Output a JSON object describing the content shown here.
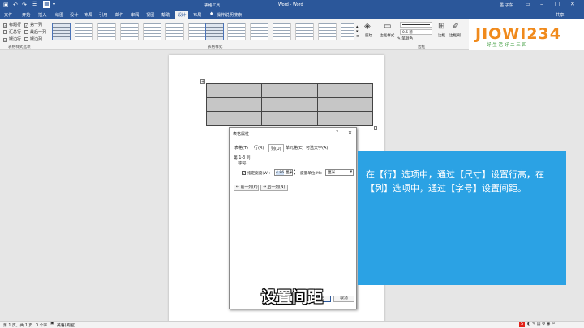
{
  "titlebar": {
    "context_tab": "表格工具",
    "doc_title": "Word - Word",
    "user": "墨 子东"
  },
  "menu": [
    "文件",
    "开始",
    "插入",
    "绘图",
    "设计",
    "布局",
    "引用",
    "邮件",
    "审阅",
    "视图",
    "帮助",
    "设计",
    "布局",
    "操作说明搜索",
    "共享"
  ],
  "ribbon": {
    "options": [
      "标题行",
      "第一列",
      "汇总行",
      "最后一列",
      "镶边行",
      "镶边列"
    ],
    "options_checked": [
      true,
      true,
      false,
      false,
      true,
      false
    ],
    "group_style_options": "表格样式选项",
    "group_styles": "表格样式",
    "shading_label": "底纹",
    "border_styles_label": "边框样式",
    "pen_weight": "0.5 磅",
    "pen_color_label": "笔颜色",
    "borders_label": "边框",
    "border_painter_label": "边框刷",
    "group_borders": "边框"
  },
  "logo": {
    "text": "JIOWI234",
    "slogan": "好 生 活 好 二 三 四"
  },
  "dialog": {
    "title": "表格属性",
    "help": "?",
    "close": "✕",
    "tabs": [
      "表格(T)",
      "行(R)",
      "列(U)",
      "单元格(E)",
      "可选文字(A)"
    ],
    "column_info": "第 1-3 列:",
    "size_label": "字号",
    "specify_width_label": "指定宽度(W):",
    "width_value": "4.86",
    "width_unit": "厘米",
    "measure_label": "度量单位(M):",
    "measure_value": "厘米",
    "prev_col": "← 前一列(P)",
    "next_col": "→ 后一列(N)",
    "ok": "确定",
    "cancel": "取消"
  },
  "overlay_text": "在【行】选项中，通过【尺寸】设置行高，在【列】选项中，通过【字号】设置间距。",
  "caption": "设置间距",
  "status": {
    "page": "第 1 页，共 1 页",
    "words": "0 个字",
    "lang": "英语(美国)"
  },
  "colors": {
    "word_blue": "#2b579a",
    "overlay_blue": "#2ba2e4"
  }
}
